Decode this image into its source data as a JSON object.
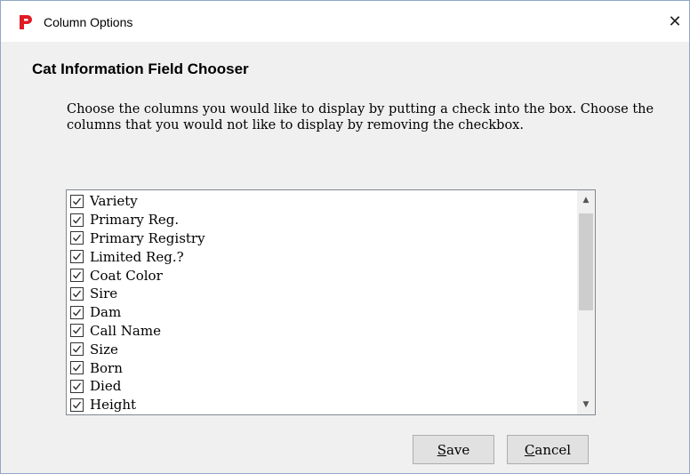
{
  "window": {
    "title": "Column Options",
    "close_glyph": "✕",
    "app_icon": "red-p-logo-icon",
    "accent_color": "#e01b24"
  },
  "dialog": {
    "heading": "Cat Information Field Chooser",
    "instructions": "Choose the columns you would like to display by putting a check into the box.  Choose the columns that you would not like to display by removing the checkbox."
  },
  "fields": [
    {
      "label": "Variety",
      "checked": true
    },
    {
      "label": "Primary Reg.",
      "checked": true
    },
    {
      "label": "Primary Registry",
      "checked": true
    },
    {
      "label": "Limited Reg.?",
      "checked": true
    },
    {
      "label": "Coat Color",
      "checked": true
    },
    {
      "label": "Sire",
      "checked": true
    },
    {
      "label": "Dam",
      "checked": true
    },
    {
      "label": "Call Name",
      "checked": true
    },
    {
      "label": "Size",
      "checked": true
    },
    {
      "label": "Born",
      "checked": true
    },
    {
      "label": "Died",
      "checked": true
    },
    {
      "label": "Height",
      "checked": true
    }
  ],
  "scrollbar": {
    "up_glyph": "▲",
    "down_glyph": "▼"
  },
  "buttons": {
    "save_mnemonic": "S",
    "save_rest": "ave",
    "cancel_mnemonic": "C",
    "cancel_rest": "ancel"
  }
}
